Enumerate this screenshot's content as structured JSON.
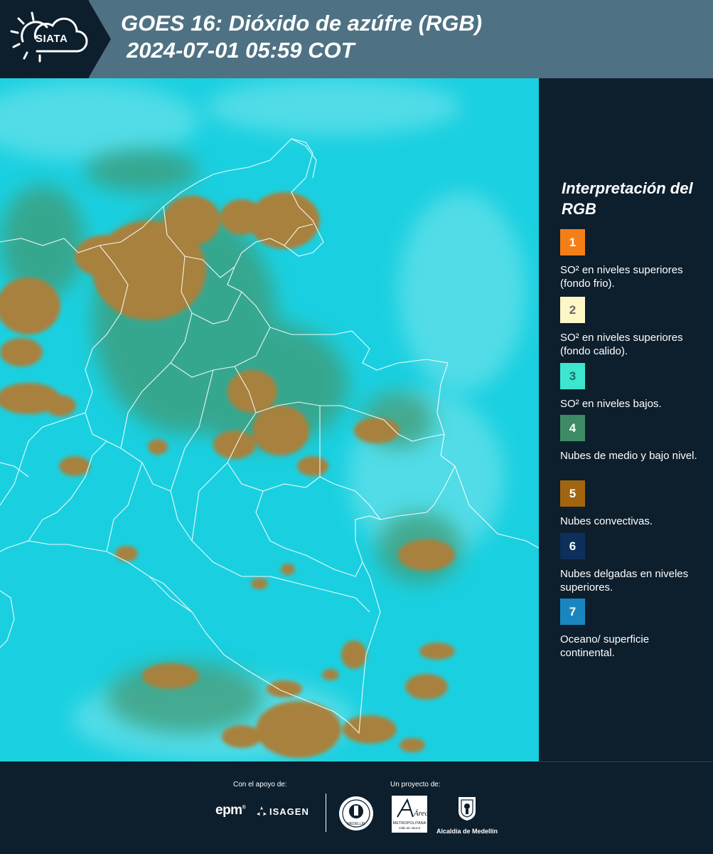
{
  "header": {
    "logo_text": "SIATA",
    "title_line1": "GOES 16: Dióxido de azúfre (RGB)",
    "title_line2": "2024-07-01 05:59 COT",
    "background_color": "#4e7283"
  },
  "map": {
    "description_icon": "satellite-rgb-map",
    "ocean_color": "#1ad0e0",
    "convective_color": "#a7813c",
    "low_cloud_color": "#4a9c6c",
    "border_color": "#ffffff"
  },
  "legend": {
    "title": "Interpretación del RGB",
    "items": [
      {
        "number": "1",
        "color": "#f57f17",
        "label": "SO² en niveles superiores (fondo frio)."
      },
      {
        "number": "2",
        "color": "#fdf7c8",
        "label": "SO² en niveles superiores (fondo calido)."
      },
      {
        "number": "3",
        "color": "#3ce6cf",
        "label": "SO² en niveles bajos."
      },
      {
        "number": "4",
        "color": "#3d8b64",
        "label": "Nubes de medio y bajo nivel."
      },
      {
        "number": "5",
        "color": "#a0650e",
        "label": "Nubes convectivas."
      },
      {
        "number": "6",
        "color": "#0d2f5c",
        "label": "Nubes delgadas en niveles superiores."
      },
      {
        "number": "7",
        "color": "#1a86c0",
        "label": "Oceano/ superficie continental."
      }
    ]
  },
  "footer": {
    "support_label": "Con el apoyo de:",
    "project_label": "Un proyecto de:",
    "epm": "epm",
    "isagen": "ISAGEN",
    "area_logo_text": "Área",
    "area_subtitle": "METROPOLITANA",
    "area_subtitle2": "Valle de Aburrá",
    "seal_text": "MEDELLIN",
    "alcaldia": "Alcaldía de Medellín"
  }
}
